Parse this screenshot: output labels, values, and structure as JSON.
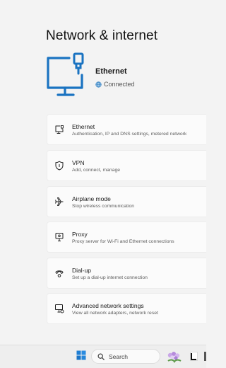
{
  "page": {
    "title": "Network & internet"
  },
  "hero": {
    "icon": "ethernet-monitor-icon",
    "name": "Ethernet",
    "status_icon": "globe-icon",
    "status": "Connected",
    "accent": "#1a73c1"
  },
  "items": [
    {
      "id": "ethernet",
      "icon": "ethernet-icon",
      "label": "Ethernet",
      "desc": "Authentication, IP and DNS settings, metered network"
    },
    {
      "id": "vpn",
      "icon": "shield-icon",
      "label": "VPN",
      "desc": "Add, connect, manage"
    },
    {
      "id": "airplane",
      "icon": "airplane-icon",
      "label": "Airplane mode",
      "desc": "Stop wireless communication"
    },
    {
      "id": "proxy",
      "icon": "proxy-icon",
      "label": "Proxy",
      "desc": "Proxy server for Wi-Fi and Ethernet connections"
    },
    {
      "id": "dialup",
      "icon": "dialup-icon",
      "label": "Dial-up",
      "desc": "Set up a dial-up internet connection"
    },
    {
      "id": "advanced",
      "icon": "advanced-network-icon",
      "label": "Advanced network settings",
      "desc": "View all network adapters, network reset"
    }
  ],
  "taskbar": {
    "start_icon": "windows-logo-icon",
    "search_icon": "search-icon",
    "search_placeholder": "Search",
    "widget_icon": "flower-icon",
    "app_icon": "app-icon"
  }
}
